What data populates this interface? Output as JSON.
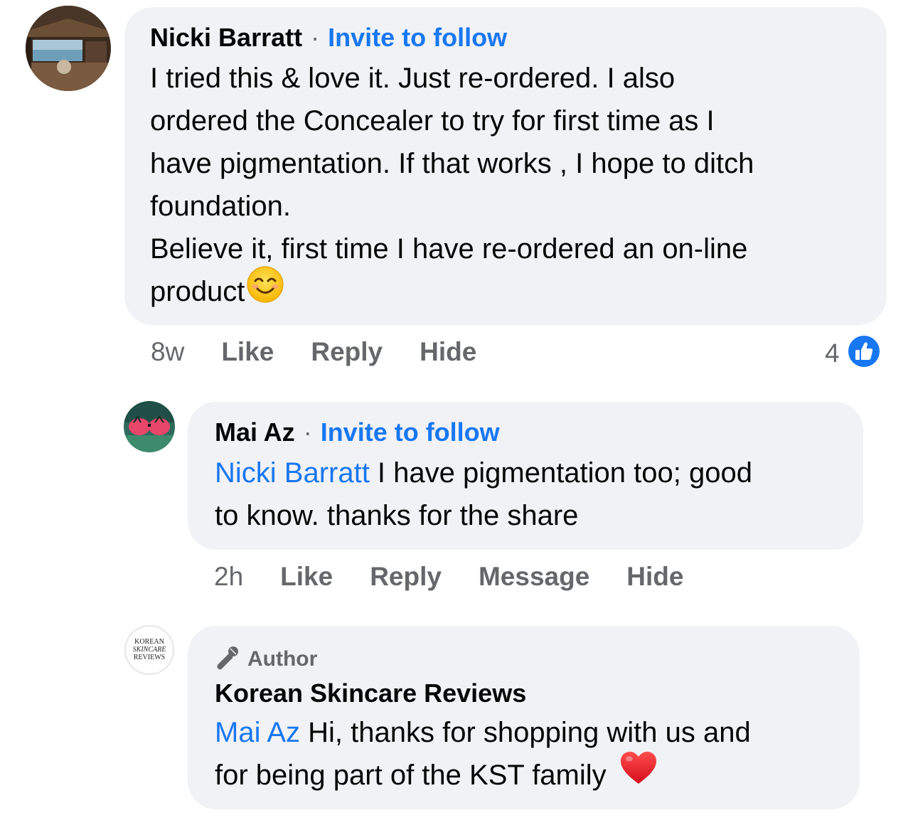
{
  "comments": [
    {
      "author": "Nicki Barratt",
      "separator": "·",
      "invite": "Invite to follow",
      "lines": [
        "I tried this & love it.  Just re-ordered. I also",
        "ordered the Concealer to try for first time as I",
        "have pigmentation.  If that works , I hope to ditch",
        "foundation.",
        "Believe it, first time I have re-ordered an on-line"
      ],
      "last_line": "product",
      "emoji": "smiling-face-icon",
      "time": "8w",
      "like": "Like",
      "reply": "Reply",
      "hide": "Hide",
      "reaction_count": "4",
      "reaction_icon": "thumbs-up-icon"
    },
    {
      "author": "Mai Az",
      "separator": "·",
      "invite": "Invite to follow",
      "mention": "Nicki Barratt",
      "line1_rest": " I have pigmentation too; good",
      "line2": "to know. thanks for the share",
      "time": "2h",
      "like": "Like",
      "reply": "Reply",
      "message": "Message",
      "hide": "Hide"
    },
    {
      "badge": "Author",
      "badge_icon": "microphone-icon",
      "author": "Korean Skincare Reviews",
      "avatar_logo": [
        "KOREAN",
        "SKINCARE",
        "REVIEWS"
      ],
      "mention": "Mai Az",
      "line1_rest": " Hi, thanks for shopping with us and",
      "line2": "for being part of the KST family",
      "emoji": "red-heart-icon"
    }
  ],
  "colors": {
    "bubble": "#f0f2f5",
    "link": "#1877f2",
    "meta": "#65676b",
    "text": "#050505"
  }
}
